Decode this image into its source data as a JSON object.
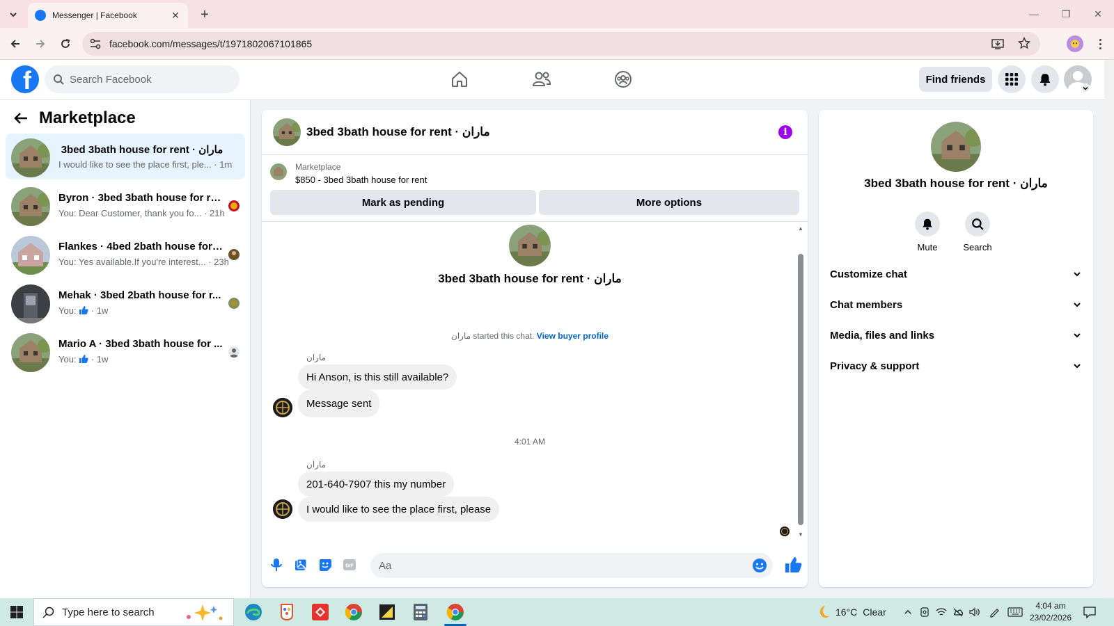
{
  "browser": {
    "tab_title": "Messenger | Facebook",
    "url": "facebook.com/messages/t/1971802067101865"
  },
  "fb_nav": {
    "search_placeholder": "Search Facebook",
    "find_friends_label": "Find friends",
    "logo_letter": "f"
  },
  "sidebar": {
    "title": "Marketplace",
    "conversations": [
      {
        "name": "3bed 3bath house for rent · ماران",
        "snippet": "I would like to see the place first, ple... · 1m",
        "active": true
      },
      {
        "name": "Byron · 3bed 3bath house for rent",
        "snippet": "You: Dear Customer, thank you fo... · 21h"
      },
      {
        "name": "Flankes · 4bed 2bath house for r...",
        "snippet": "You: Yes available.If you're interest... · 23h"
      },
      {
        "name": "Mehak · 3bed 2bath house for r...",
        "snippet_prefix": "You:",
        "snippet_suffix": "· 1w"
      },
      {
        "name": "Mario A · 3bed 3bath house for ...",
        "snippet_prefix": "You:",
        "snippet_suffix": "· 1w"
      }
    ]
  },
  "chat": {
    "title": "3bed 3bath house for rent · ماران",
    "listing_source": "Marketplace",
    "listing_price_title": "$850 - 3bed 3bath house for rent",
    "mark_pending_label": "Mark as pending",
    "more_options_label": "More options",
    "intro_name": "3bed 3bath house for rent · ماران",
    "started_text": "ماران started this chat.",
    "view_buyer_profile": "View buyer profile",
    "sender_name": "ماران",
    "messages_group1": [
      "Hi Anson, is this still available?",
      "Message sent"
    ],
    "time_separator": "4:01 AM",
    "messages_group2": [
      "201-640-7907 this my number",
      "I would like to see the place first, please"
    ],
    "composer_placeholder": "Aa"
  },
  "info_panel": {
    "name": "3bed 3bath house for rent · ماران",
    "mute_label": "Mute",
    "search_label": "Search",
    "sections": [
      "Customize chat",
      "Chat members",
      "Media, files and links",
      "Privacy & support"
    ]
  },
  "taskbar": {
    "search_placeholder": "Type here to search",
    "weather_temp": "16°C",
    "weather_desc": "Clear",
    "time": "4:04 am",
    "date": "23/02/2026"
  },
  "colors": {
    "fb_blue": "#1877f2",
    "messenger_purple": "#9d07e8",
    "active_convo_bg": "#e7f3ff",
    "browser_tabbar": "#f6e2e6",
    "taskbar": "#cfe9e3"
  }
}
